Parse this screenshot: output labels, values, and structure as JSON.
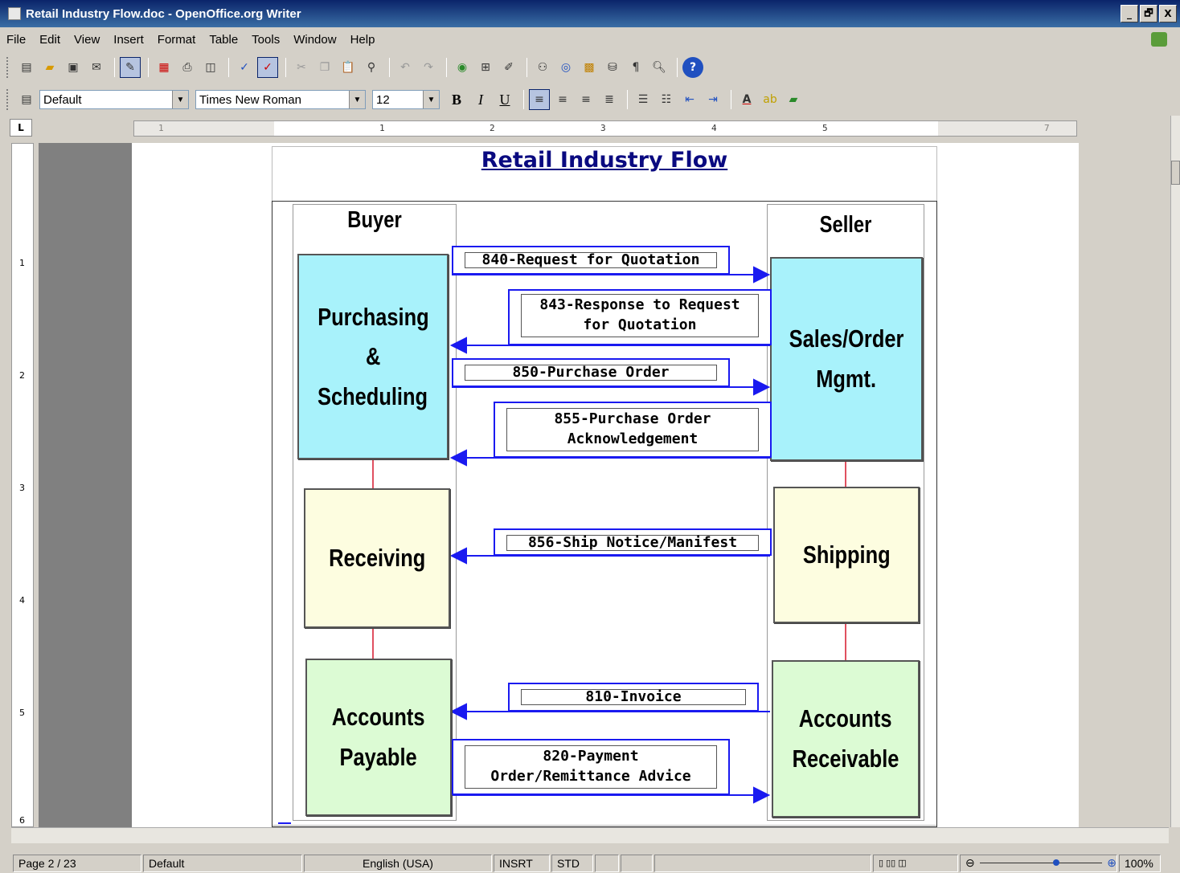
{
  "window": {
    "title": "Retail Industry Flow.doc - OpenOffice.org Writer",
    "min": "_",
    "max": "🗗",
    "close": "X"
  },
  "menu": [
    "File",
    "Edit",
    "View",
    "Insert",
    "Format",
    "Table",
    "Tools",
    "Window",
    "Help"
  ],
  "toolbar2": {
    "style": "Default",
    "font": "Times New Roman",
    "size": "12"
  },
  "ruler": {
    "h_ticks": [
      "1",
      "1",
      "2",
      "3",
      "4",
      "5",
      "7"
    ],
    "v_ticks": [
      "1",
      "2",
      "3",
      "4",
      "5",
      "6"
    ]
  },
  "doc": {
    "title": "Retail Industry Flow",
    "buyer": "Buyer",
    "seller": "Seller",
    "boxes": {
      "purchasing": [
        "Purchasing",
        "&",
        "Scheduling"
      ],
      "sales": [
        "Sales/Order",
        "Mgmt."
      ],
      "receiving": "Receiving",
      "shipping": "Shipping",
      "payable": [
        "Accounts",
        "Payable"
      ],
      "receivable": [
        "Accounts",
        "Receivable"
      ]
    },
    "messages": {
      "m840": "840-Request for  Quotation",
      "m843": [
        "843-Response to Request",
        "for Quotation"
      ],
      "m850": "850-Purchase Order",
      "m855": [
        "855-Purchase Order",
        "Acknowledgement"
      ],
      "m856": "856-Ship Notice/Manifest",
      "m810": "810-Invoice",
      "m820": [
        "820-Payment",
        "Order/Remittance Advice"
      ]
    }
  },
  "status": {
    "page": "Page 2 / 23",
    "style": "Default",
    "language": "English (USA)",
    "mode": "INSRT",
    "sel": "STD",
    "zoom": "100%"
  }
}
